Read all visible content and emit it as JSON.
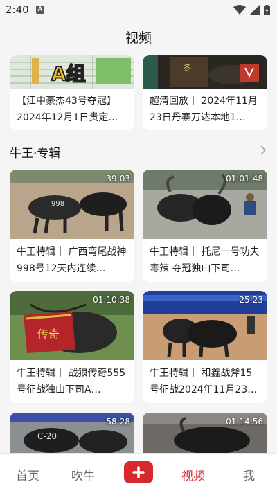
{
  "status": {
    "time": "2:40",
    "notification_badge": "A"
  },
  "header": {
    "title": "视频"
  },
  "top_cards": [
    {
      "title": "【江中豪杰43号夺冠】2024年12月1日贵定…",
      "thumb_text": "A组"
    },
    {
      "title": "超清回放丨 2024年11月23日丹寨万达本地1…",
      "thumb_text": "冬"
    }
  ],
  "section": {
    "title": "牛王·专辑"
  },
  "videos": [
    {
      "duration": "39:03",
      "title": "牛王特辑丨 广西弯尾战神998号12天内连续…"
    },
    {
      "duration": "01:01:48",
      "title": "牛王特辑丨 托尼一号功夫毒辣 夺冠独山下司…"
    },
    {
      "duration": "01:10:38",
      "title": "牛王特辑丨 战狼传奇555号征战独山下司A…",
      "thumb_text": "传奇"
    },
    {
      "duration": "25:23",
      "title": "牛王特辑丨 和鑫战斧15号征战2024年11月23…"
    },
    {
      "duration": "58:28",
      "title": "",
      "thumb_text": "C-20"
    },
    {
      "duration": "01:14:56",
      "title": ""
    }
  ],
  "bottom_nav": {
    "home": "首页",
    "chuiniu": "吹牛",
    "add": "+",
    "video": "视频",
    "me": "我"
  },
  "colors": {
    "accent": "#d9272e",
    "background": "#f5f5f5"
  }
}
